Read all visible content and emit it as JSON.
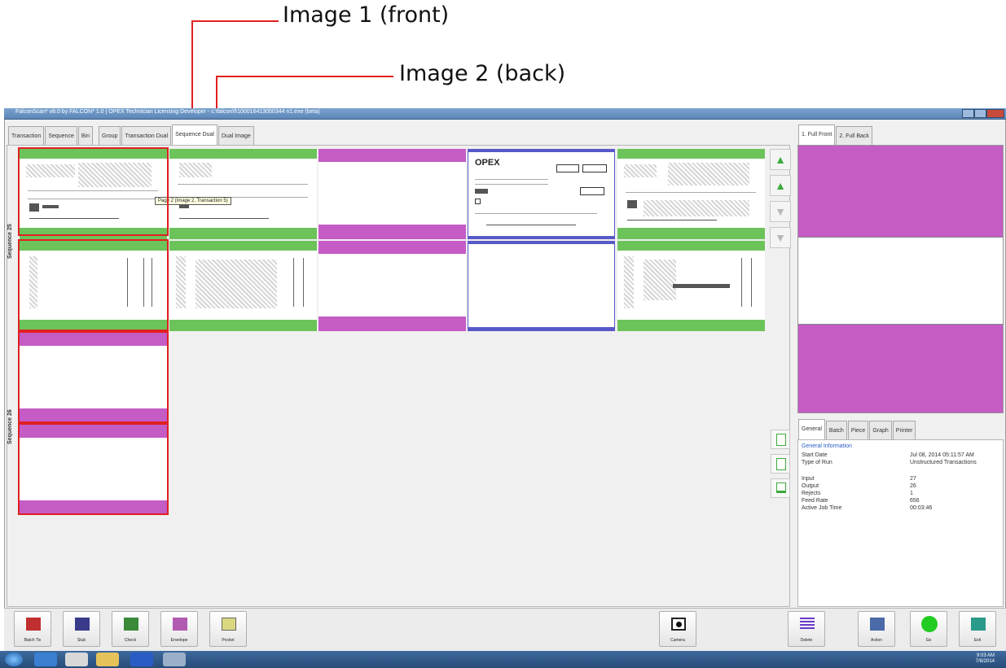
{
  "callouts": {
    "front": "Image 1 (front)",
    "back": "Image 2 (back)"
  },
  "window": {
    "title": "FalconScan* v8.0 by FALCON* 1.0 | OPEX Technician Licensing Developer - c:\\falcon\\f\\100016413050344 n1.exe (beta)"
  },
  "tabs": [
    {
      "label": "Transaction"
    },
    {
      "label": "Sequence"
    },
    {
      "label": "Bin"
    },
    {
      "label": "Group"
    },
    {
      "label": "Transaction Dual"
    },
    {
      "label": "Sequence Dual"
    },
    {
      "label": "Dual Image"
    }
  ],
  "sequences": [
    {
      "label": "Sequence 25"
    },
    {
      "label": "Sequence 26"
    }
  ],
  "tile_tooltip": "Page 2 (Image 2, Transaction 5)",
  "preview_tabs": [
    {
      "label": "1. Full Front"
    },
    {
      "label": "2. Full Back"
    }
  ],
  "info_tabs": [
    {
      "label": "General"
    },
    {
      "label": "Batch"
    },
    {
      "label": "Piece"
    },
    {
      "label": "Graph"
    },
    {
      "label": "Printer"
    }
  ],
  "info": {
    "heading": "General Information",
    "rows": [
      {
        "key": "Start Date",
        "value": "Jul 08, 2014 05:11:57 AM"
      },
      {
        "key": "Type of Run",
        "value": "Unstructured Transactions"
      },
      {
        "key": "Input",
        "value": "27"
      },
      {
        "key": "Output",
        "value": "26"
      },
      {
        "key": "Rejects",
        "value": "1"
      },
      {
        "key": "Feed Rate",
        "value": "656"
      },
      {
        "key": "Active Job Time",
        "value": "00:03:46"
      }
    ]
  },
  "toolbar": {
    "left": [
      {
        "label": "Batch Tix",
        "color": "#c03030"
      },
      {
        "label": "Stub",
        "color": "#3a3a8a"
      },
      {
        "label": "Check",
        "color": "#3a8a3a"
      },
      {
        "label": "Envelope",
        "color": "#b05ab0"
      },
      {
        "label": "Pocket",
        "color": "#d8d880"
      }
    ],
    "camera": "Camera",
    "right": [
      {
        "label": "Delete",
        "color": "#6a3ac8"
      },
      {
        "label": "Action",
        "color": "#4a6aa8"
      },
      {
        "label": "Go",
        "color": "#22cc22"
      },
      {
        "label": "Exit",
        "color": "#2a9a8a"
      }
    ]
  },
  "taskbar": {
    "time": "9:03 AM",
    "date": "7/8/2014"
  },
  "colors": {
    "green_band": "#6cc35a",
    "magenta_band": "#c55bc5",
    "blue_band": "#5858c8",
    "highlight": "#e02020"
  }
}
